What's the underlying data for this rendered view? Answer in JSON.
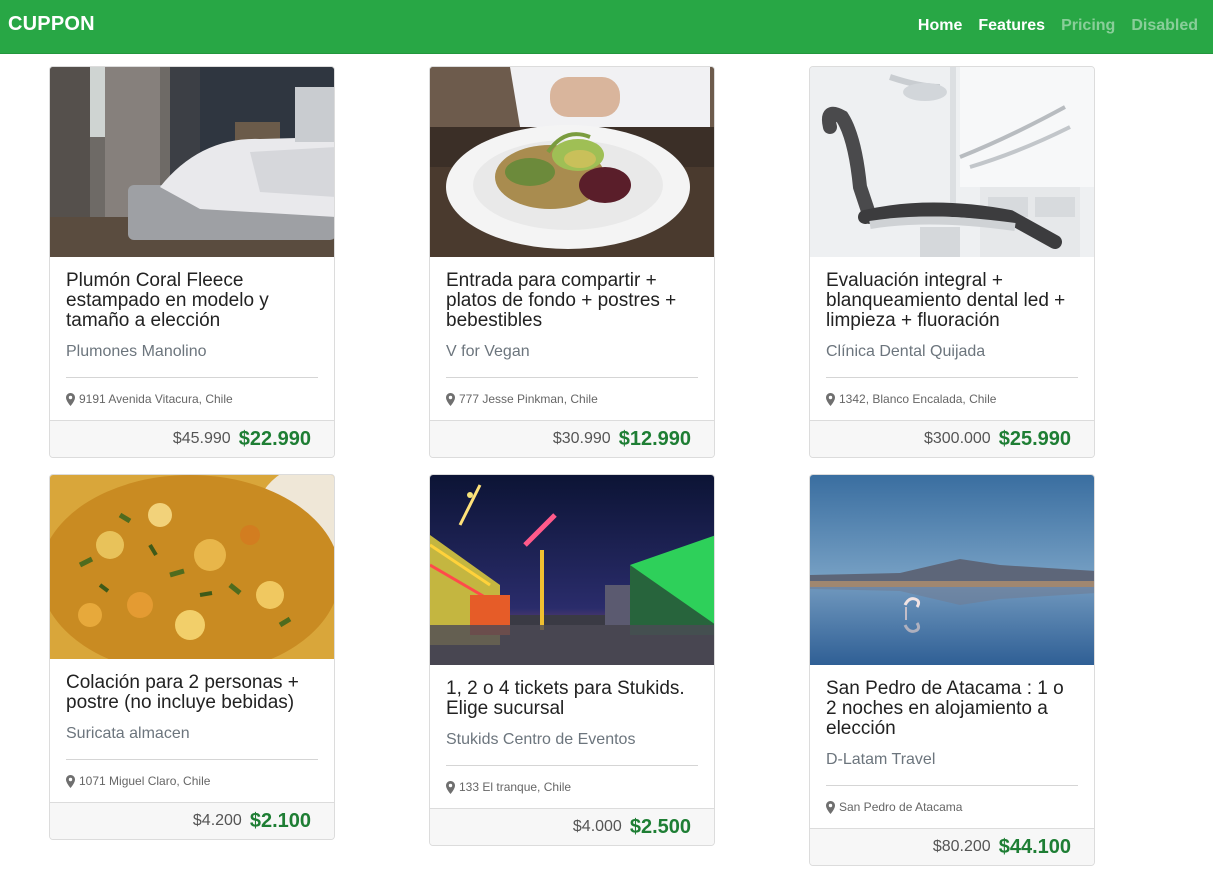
{
  "navbar": {
    "brand": "CUPPON",
    "links": [
      {
        "label": "Home",
        "state": "active"
      },
      {
        "label": "Features",
        "state": "active"
      },
      {
        "label": "Pricing",
        "state": "muted"
      },
      {
        "label": "Disabled",
        "state": "muted"
      }
    ]
  },
  "cards": [
    {
      "title": "Plumón Coral Fleece estampado en modelo y tamaño a elección",
      "merchant": "Plumones Manolino",
      "location": "9191 Avenida Vitacura, Chile",
      "old_price": "$45.990",
      "new_price": "$22.990",
      "image": "bedroom-photo"
    },
    {
      "title": "Entrada para compartir + platos de fondo + postres + bebestibles",
      "merchant": "V for Vegan",
      "location": "777 Jesse Pinkman, Chile",
      "old_price": "$30.990",
      "new_price": "$12.990",
      "image": "salad-plate-photo"
    },
    {
      "title": "Evaluación integral + blanqueamiento dental led + limpieza + fluoración",
      "merchant": "Clínica Dental Quijada",
      "location": "1342, Blanco Encalada, Chile",
      "old_price": "$300.000",
      "new_price": "$25.990",
      "image": "dental-chair-photo"
    },
    {
      "title": "Colación para 2 personas + postre (no incluye bebidas)",
      "merchant": "Suricata almacen",
      "location": "1071 Miguel Claro, Chile",
      "old_price": "$4.200",
      "new_price": "$2.100",
      "image": "food-dish-photo"
    },
    {
      "title": "1, 2 o 4 tickets para Stukids. Elige sucursal",
      "merchant": "Stukids Centro de Eventos",
      "location": "133 El tranque, Chile",
      "old_price": "$4.000",
      "new_price": "$2.500",
      "image": "fairground-photo"
    },
    {
      "title": "San Pedro de Atacama : 1 o 2 noches en alojamiento a elección",
      "merchant": "D-Latam Travel",
      "location": "San Pedro de Atacama",
      "old_price": "$80.200",
      "new_price": "$44.100",
      "image": "atacama-lagoon-photo"
    }
  ],
  "colors": {
    "navbar": "#28a745",
    "price": "#1e7e34"
  }
}
